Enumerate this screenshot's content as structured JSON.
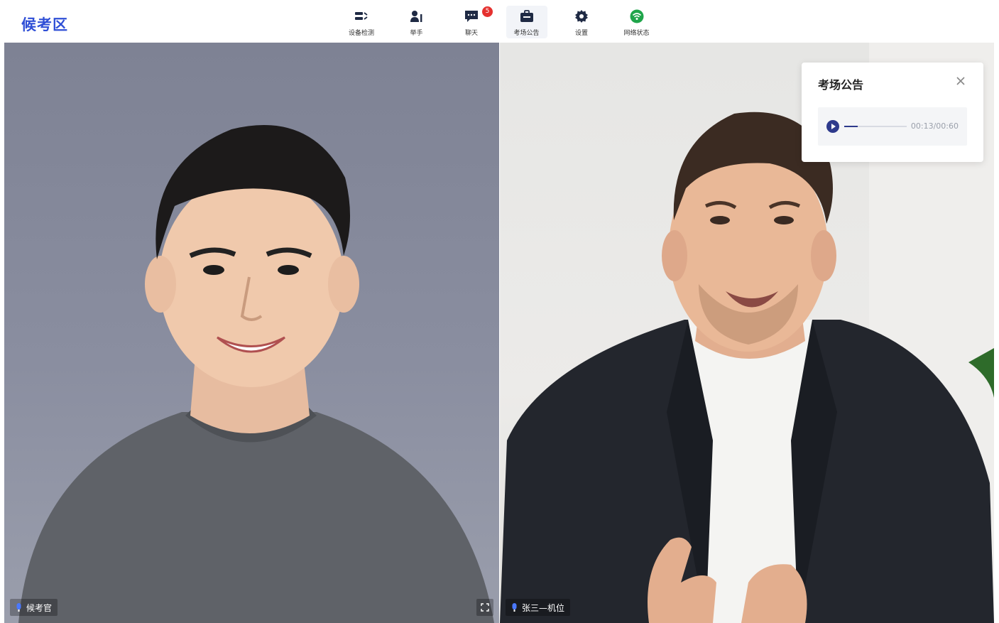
{
  "app": {
    "title": "候考区",
    "brand_color": "#2f4fd6"
  },
  "toolbar": {
    "items": [
      {
        "label": "设备检测",
        "icon": "device-check-icon",
        "active": false
      },
      {
        "label": "举手",
        "icon": "raise-hand-icon",
        "active": false
      },
      {
        "label": "聊天",
        "icon": "chat-icon",
        "active": false,
        "badge": "5"
      },
      {
        "label": "考场公告",
        "icon": "announcement-icon",
        "active": true
      },
      {
        "label": "设置",
        "icon": "gear-icon",
        "active": false
      },
      {
        "label": "网络状态",
        "icon": "wifi-icon",
        "active": false,
        "status_color": "#1fa54a"
      }
    ]
  },
  "feeds": {
    "left": {
      "name": "候考官"
    },
    "right": {
      "name": "张三—机位"
    }
  },
  "notice": {
    "title": "考场公告",
    "audio": {
      "current": "00:13",
      "total": "00:60",
      "time_text": "00:13/00:60",
      "progress": 0.217
    }
  }
}
